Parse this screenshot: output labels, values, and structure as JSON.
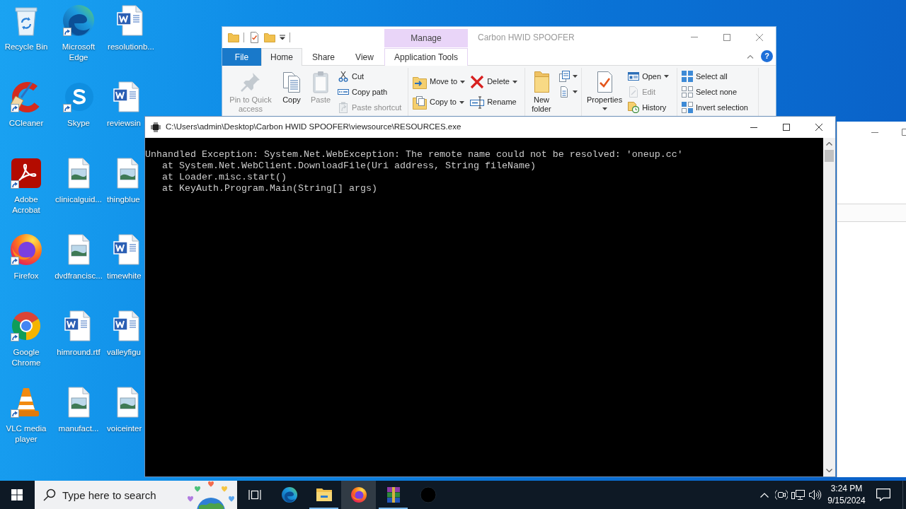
{
  "desktop": {
    "icons": [
      {
        "label": "Recycle Bin",
        "kind": "recycle",
        "shortcut": false
      },
      {
        "label": "Microsoft Edge",
        "kind": "edge",
        "shortcut": true
      },
      {
        "label": "resolutionb...",
        "kind": "word",
        "shortcut": false
      },
      {
        "label": "CCleaner",
        "kind": "ccleaner",
        "shortcut": true
      },
      {
        "label": "Skype",
        "kind": "skype",
        "shortcut": true
      },
      {
        "label": "reviewsin",
        "kind": "word",
        "shortcut": false
      },
      {
        "label": "Adobe Acrobat",
        "kind": "acrobat",
        "shortcut": true
      },
      {
        "label": "clinicalguid...",
        "kind": "image",
        "shortcut": false
      },
      {
        "label": "thingblue",
        "kind": "image",
        "shortcut": false
      },
      {
        "label": "Firefox",
        "kind": "firefox",
        "shortcut": true
      },
      {
        "label": "dvdfrancisc...",
        "kind": "image",
        "shortcut": false
      },
      {
        "label": "timewhite",
        "kind": "word",
        "shortcut": false
      },
      {
        "label": "Google Chrome",
        "kind": "chrome",
        "shortcut": true
      },
      {
        "label": "himround.rtf",
        "kind": "word",
        "shortcut": false
      },
      {
        "label": "valleyfigu",
        "kind": "word",
        "shortcut": false
      },
      {
        "label": "VLC media player",
        "kind": "vlc",
        "shortcut": true
      },
      {
        "label": "manufact...",
        "kind": "image",
        "shortcut": false
      },
      {
        "label": "voiceinter",
        "kind": "image",
        "shortcut": false
      }
    ]
  },
  "explorer": {
    "context_tab_group": "Manage",
    "title": "Carbon HWID SPOOFER",
    "tabs": [
      {
        "label": "File",
        "kind": "file",
        "selected": false
      },
      {
        "label": "Home",
        "kind": "tab",
        "selected": true
      },
      {
        "label": "Share",
        "kind": "tab",
        "selected": false
      },
      {
        "label": "View",
        "kind": "tab",
        "selected": false
      },
      {
        "label": "Application Tools",
        "kind": "context",
        "selected": false
      }
    ],
    "help": "?",
    "ribbon": {
      "groups": [
        {
          "items": [
            {
              "kind": "large",
              "label": "Pin to Quick access",
              "disabled": true,
              "dropdown": false
            },
            {
              "kind": "large",
              "label": "Copy",
              "disabled": false,
              "dropdown": false
            },
            {
              "kind": "large",
              "label": "Paste",
              "disabled": true,
              "dropdown": false
            },
            {
              "kind": "stack",
              "commands": [
                {
                  "label": "Cut",
                  "disabled": false,
                  "dropdown": false
                },
                {
                  "label": "Copy path",
                  "disabled": false,
                  "dropdown": false
                },
                {
                  "label": "Paste shortcut",
                  "disabled": true,
                  "dropdown": false
                }
              ]
            }
          ]
        },
        {
          "items": [
            {
              "kind": "stack",
              "commands": [
                {
                  "label": "Move to",
                  "disabled": false,
                  "dropdown": true
                },
                {
                  "label": "Copy to",
                  "disabled": false,
                  "dropdown": true
                }
              ]
            },
            {
              "kind": "stack",
              "commands": [
                {
                  "label": "Delete",
                  "disabled": false,
                  "dropdown": true
                },
                {
                  "label": "Rename",
                  "disabled": false,
                  "dropdown": false
                }
              ]
            }
          ]
        },
        {
          "items": [
            {
              "kind": "large",
              "label": "New folder",
              "disabled": false,
              "dropdown": false
            },
            {
              "kind": "stack",
              "commands": [
                {
                  "disabled": false,
                  "dropdown": true
                },
                {
                  "disabled": false,
                  "dropdown": true
                }
              ]
            }
          ]
        },
        {
          "items": [
            {
              "kind": "large",
              "label": "Properties",
              "disabled": false,
              "dropdown": true
            },
            {
              "kind": "stack",
              "commands": [
                {
                  "label": "Open",
                  "disabled": false,
                  "dropdown": true
                },
                {
                  "label": "Edit",
                  "disabled": true,
                  "dropdown": false
                },
                {
                  "label": "History",
                  "disabled": false,
                  "dropdown": false
                }
              ]
            }
          ]
        },
        {
          "items": [
            {
              "kind": "stack",
              "commands": [
                {
                  "label": "Select all",
                  "disabled": false,
                  "dropdown": false
                },
                {
                  "label": "Select none",
                  "disabled": false,
                  "dropdown": false
                },
                {
                  "label": "Invert selection",
                  "disabled": false,
                  "dropdown": false
                }
              ]
            }
          ]
        }
      ]
    }
  },
  "console": {
    "title": "C:\\Users\\admin\\Desktop\\Carbon HWID SPOOFER\\viewsource\\RESOURCES.exe",
    "message": "Unhandled Exception: System.Net.WebException: The remote name could not be resolved: 'oneup.cc'",
    "stack_trace": [
      "at System.Net.WebClient.DownloadFile(Uri address, String fileName)",
      "at Loader.misc.start()",
      "at KeyAuth.Program.Main(String[] args)"
    ]
  },
  "taskbar": {
    "search": {
      "placeholder": "Type here to search"
    },
    "apps": [
      {
        "kind": "edge",
        "running": false,
        "selected": false
      },
      {
        "kind": "explorer",
        "running": true,
        "selected": false
      },
      {
        "kind": "firefox",
        "running": false,
        "selected": true
      },
      {
        "kind": "winrar",
        "running": true,
        "selected": false
      },
      {
        "kind": "console",
        "running": false,
        "selected": false
      }
    ],
    "clock": {
      "time": "3:24 PM",
      "date": "9/15/2024"
    }
  }
}
